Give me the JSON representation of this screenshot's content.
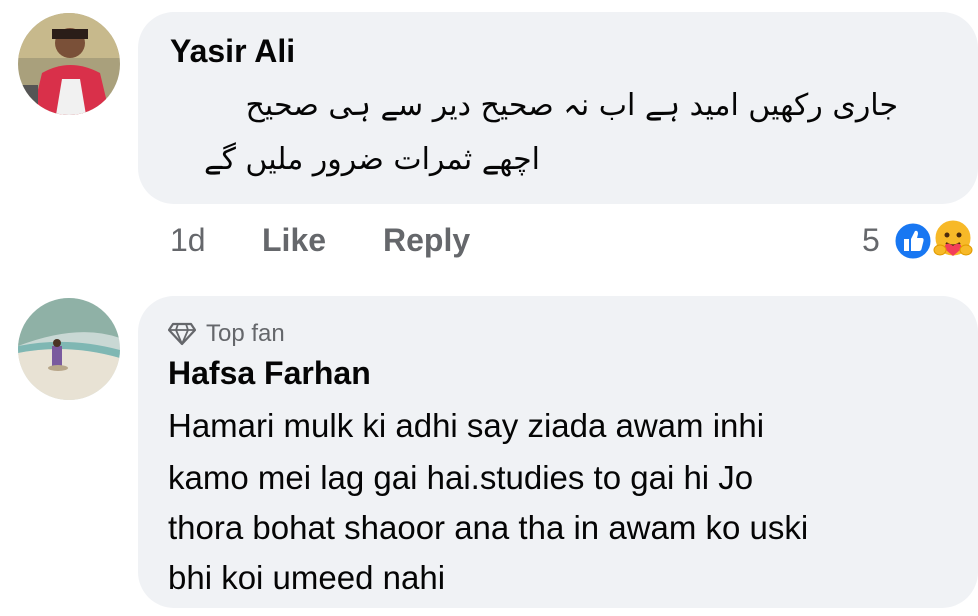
{
  "comments": [
    {
      "author": "Yasir Ali",
      "text_lines": [
        "جاری رکھیں امید ہے اب نہ صحیح دیر سے ہی صحیح",
        "اچھے ثمرات ضرور ملیں گے"
      ],
      "time": "1d",
      "like_label": "Like",
      "reply_label": "Reply",
      "reaction_count": "5",
      "reaction_icons": [
        "like-icon",
        "care-icon"
      ]
    },
    {
      "badge": "Top fan",
      "badge_icon": "diamond-icon",
      "author": "Hafsa Farhan",
      "text_lines": [
        "Hamari mulk ki adhi say ziada awam inhi",
        "kamo mei lag gai hai.studies to gai hi Jo",
        "thora bohat shaoor ana tha in awam ko uski",
        "bhi koi umeed nahi"
      ]
    }
  ],
  "colors": {
    "bubble": "#f0f2f5",
    "meta": "#65676b",
    "like_blue": "#1877f2",
    "care_yellow": "#f7b928"
  }
}
